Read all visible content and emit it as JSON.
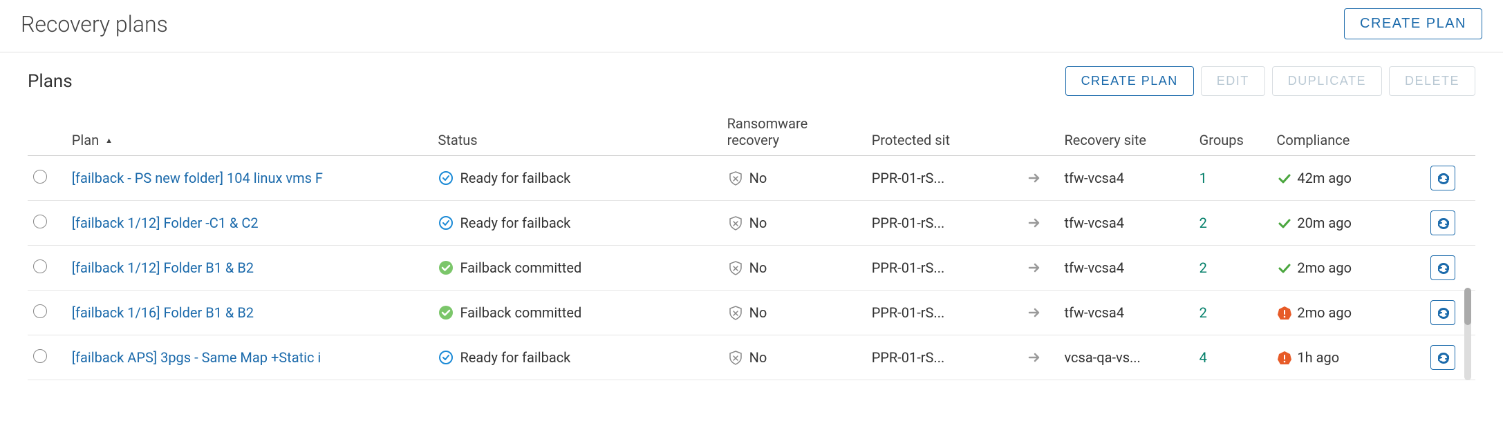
{
  "header": {
    "title": "Recovery plans",
    "create_plan": "CREATE PLAN"
  },
  "panel": {
    "title": "Plans",
    "actions": {
      "create": "CREATE PLAN",
      "edit": "EDIT",
      "duplicate": "DUPLICATE",
      "delete": "DELETE"
    }
  },
  "columns": {
    "plan": "Plan",
    "status": "Status",
    "ransomware": "Ransomware recovery",
    "protected": "Protected sit",
    "recovery": "Recovery site",
    "groups": "Groups",
    "compliance": "Compliance"
  },
  "rows": [
    {
      "plan": "[failback - PS new folder] 104 linux vms F",
      "status": "Ready for failback",
      "status_icon": "ready",
      "ransomware": "No",
      "protected": "PPR-01-rS...",
      "recovery": "tfw-vcsa4",
      "groups": "1",
      "compliance": "42m ago",
      "compliance_icon": "ok"
    },
    {
      "plan": "[failback 1/12] Folder -C1 & C2",
      "status": "Ready for failback",
      "status_icon": "ready",
      "ransomware": "No",
      "protected": "PPR-01-rS...",
      "recovery": "tfw-vcsa4",
      "groups": "2",
      "compliance": "20m ago",
      "compliance_icon": "ok"
    },
    {
      "plan": "[failback 1/12] Folder B1 & B2",
      "status": "Failback committed",
      "status_icon": "committed",
      "ransomware": "No",
      "protected": "PPR-01-rS...",
      "recovery": "tfw-vcsa4",
      "groups": "2",
      "compliance": "2mo ago",
      "compliance_icon": "ok"
    },
    {
      "plan": "[failback 1/16] Folder B1 & B2",
      "status": "Failback committed",
      "status_icon": "committed",
      "ransomware": "No",
      "protected": "PPR-01-rS...",
      "recovery": "tfw-vcsa4",
      "groups": "2",
      "compliance": "2mo ago",
      "compliance_icon": "alert"
    },
    {
      "plan": "[failback APS] 3pgs - Same Map +Static i",
      "status": "Ready for failback",
      "status_icon": "ready",
      "ransomware": "No",
      "protected": "PPR-01-rS...",
      "recovery": "vcsa-qa-vs...",
      "groups": "4",
      "compliance": "1h ago",
      "compliance_icon": "alert"
    }
  ]
}
